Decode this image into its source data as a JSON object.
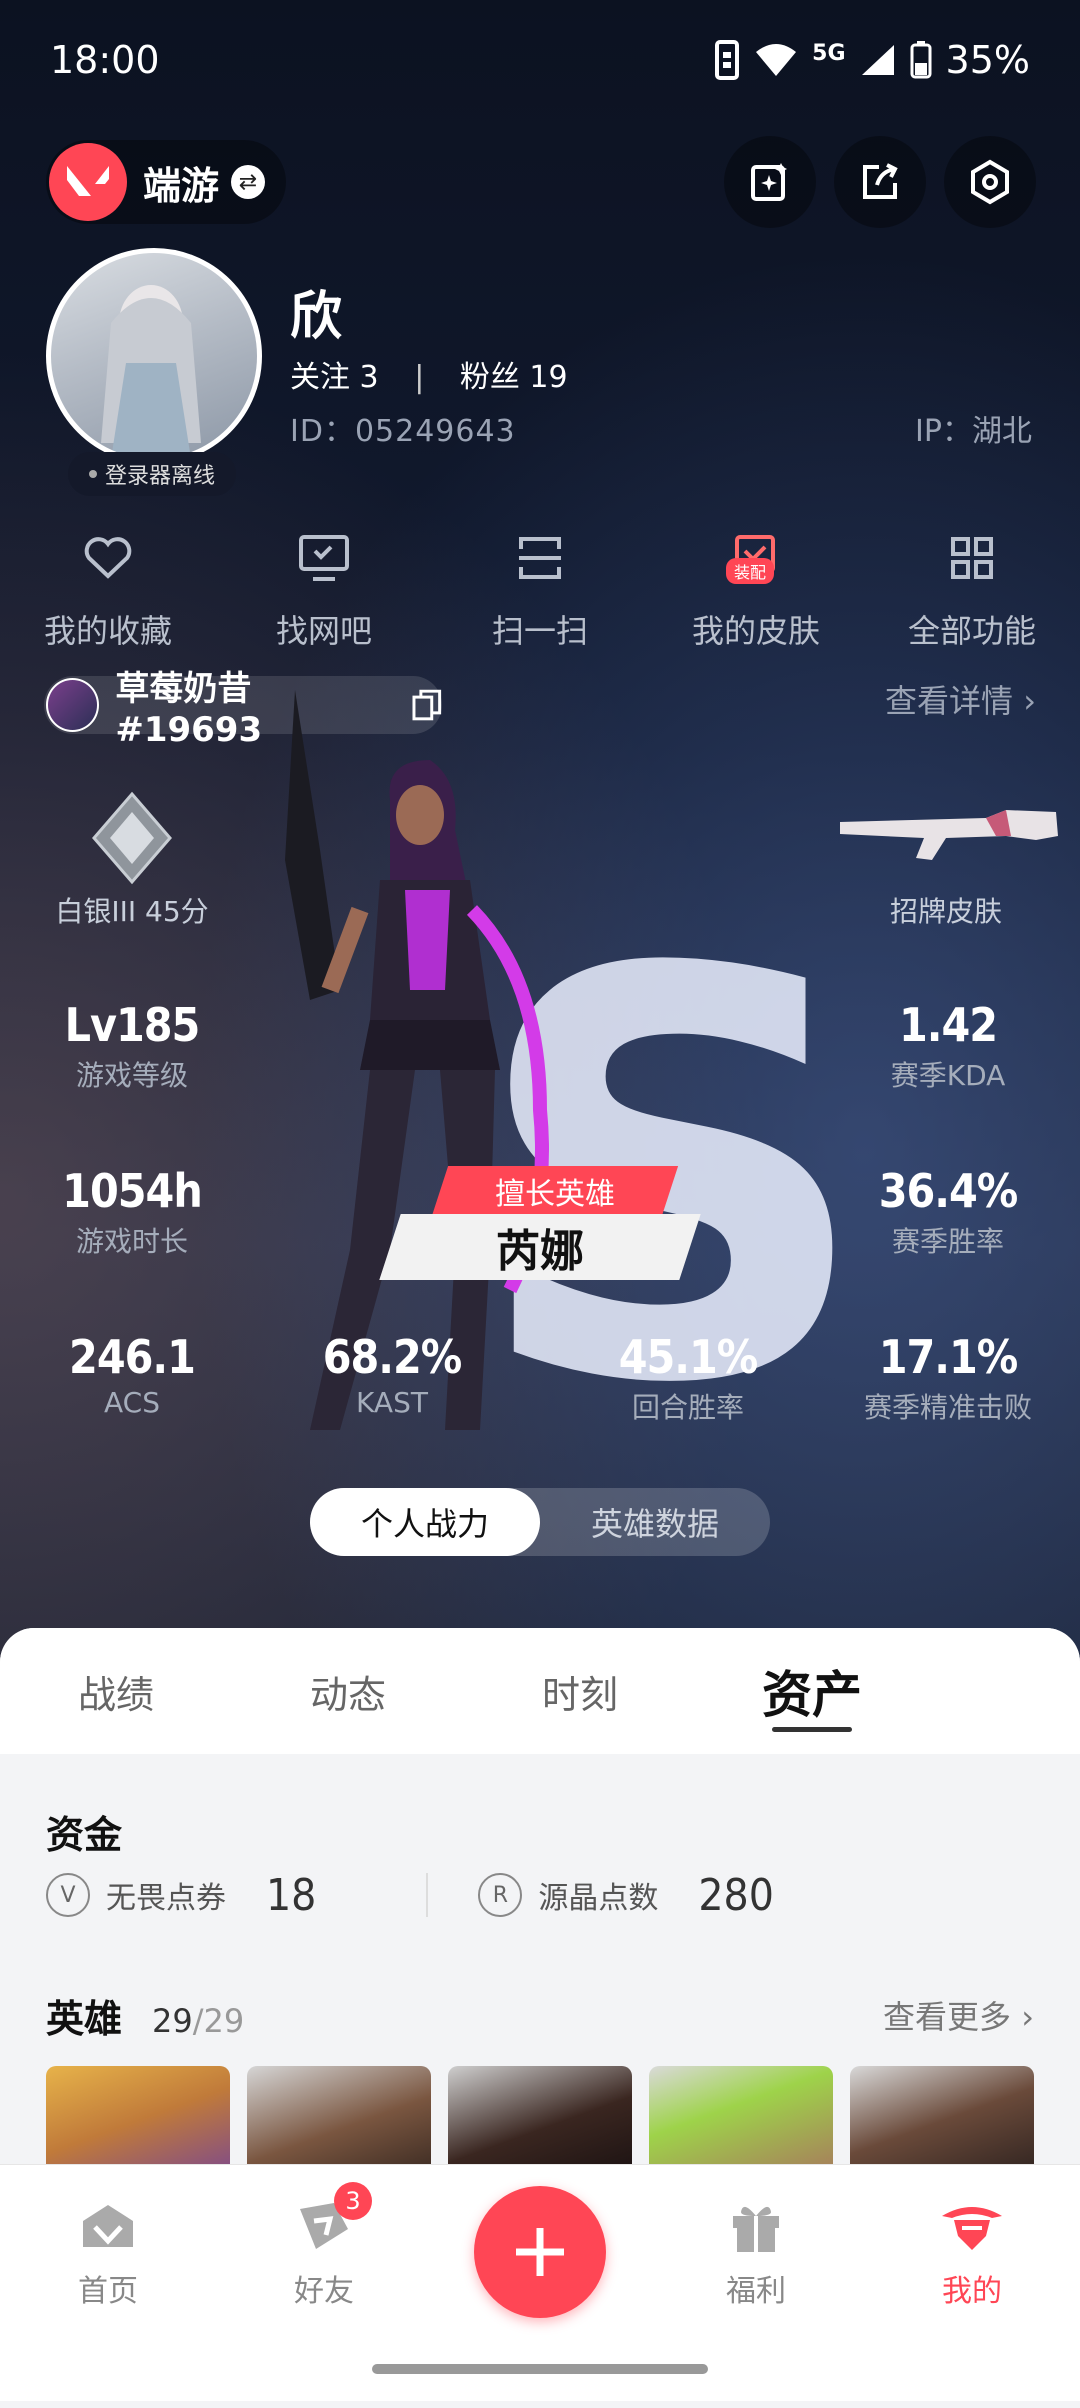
{
  "status": {
    "time": "18:00",
    "network": "5G",
    "battery": "35%"
  },
  "header": {
    "app_name": "端游"
  },
  "profile": {
    "name": "欣",
    "follow_label": "关注",
    "follow_count": "3",
    "fans_label": "粉丝",
    "fans_count": "19",
    "id_text": "ID：05249643",
    "ip_text": "IP：湖北",
    "online_status": "登录器离线"
  },
  "quick_actions": [
    {
      "label": "我的收藏",
      "icon": "heart-icon"
    },
    {
      "label": "找网吧",
      "icon": "monitor-icon"
    },
    {
      "label": "扫一扫",
      "icon": "scan-icon"
    },
    {
      "label": "我的皮肤",
      "icon": "skin-icon",
      "badge": "装配"
    },
    {
      "label": "全部功能",
      "icon": "grid-icon"
    }
  ],
  "riot_id": "草莓奶昔#19693",
  "details_link": "查看详情",
  "stats": {
    "rank": "白银III 45分",
    "signature_skin": "招牌皮肤",
    "level": {
      "value": "Lv185",
      "label": "游戏等级"
    },
    "kda": {
      "value": "1.42",
      "label": "赛季KDA"
    },
    "hours": {
      "value": "1054h",
      "label": "游戏时长"
    },
    "winrate": {
      "value": "36.4%",
      "label": "赛季胜率"
    },
    "acs": {
      "value": "246.1",
      "label": "ACS"
    },
    "kast": {
      "value": "68.2%",
      "label": "KAST"
    },
    "round_win": {
      "value": "45.1%",
      "label": "回合胜率"
    },
    "precision": {
      "value": "17.1%",
      "label": "赛季精准击败"
    }
  },
  "best_hero": {
    "tag": "擅长英雄",
    "name": "芮娜"
  },
  "segment": {
    "personal": "个人战力",
    "heroes": "英雄数据"
  },
  "tabs": [
    "战绩",
    "动态",
    "时刻",
    "资产"
  ],
  "funds": {
    "title": "资金",
    "vp_label": "无畏点券",
    "vp_value": "18",
    "rp_label": "源晶点数",
    "rp_value": "280"
  },
  "heroes_section": {
    "title": "英雄",
    "owned": "29",
    "total": "29",
    "more": "查看更多"
  },
  "nav": [
    {
      "label": "首页"
    },
    {
      "label": "好友",
      "badge": "3"
    },
    {
      "label": "福利"
    },
    {
      "label": "我的"
    }
  ],
  "colors": {
    "accent": "#ff4655"
  }
}
